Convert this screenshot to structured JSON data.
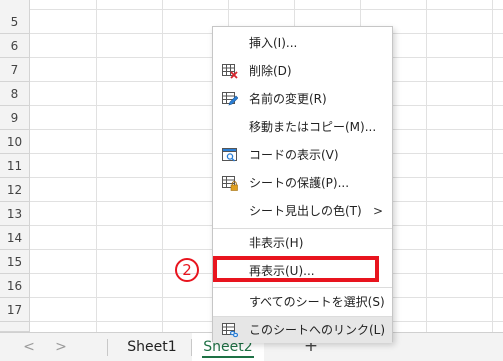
{
  "grid": {
    "rows": [
      "5",
      "6",
      "7",
      "8",
      "9",
      "10",
      "11",
      "12",
      "13",
      "14",
      "15",
      "16",
      "17"
    ]
  },
  "tabs": {
    "nav_prev": "<",
    "nav_next": ">",
    "sheet1": "Sheet1",
    "sheet2": "Sheet2",
    "add": "+"
  },
  "menu": {
    "items": [
      {
        "label": "挿入(I)...",
        "icon": "none"
      },
      {
        "label": "削除(D)",
        "icon": "delete-sheet-icon"
      },
      {
        "label": "名前の変更(R)",
        "icon": "rename-sheet-icon"
      },
      {
        "label": "移動またはコピー(M)...",
        "icon": "none"
      },
      {
        "label": "コードの表示(V)",
        "icon": "view-code-icon"
      },
      {
        "label": "シートの保護(P)...",
        "icon": "protect-sheet-icon"
      },
      {
        "label": "シート見出しの色(T)",
        "icon": "none",
        "submenu": ">"
      },
      {
        "label": "非表示(H)",
        "icon": "none"
      },
      {
        "label": "再表示(U)...",
        "icon": "none"
      },
      {
        "label": "すべてのシートを選択(S)",
        "icon": "none"
      },
      {
        "label": "このシートへのリンク(L)",
        "icon": "link-sheet-icon"
      }
    ]
  },
  "annotation": {
    "step": "2",
    "color": "#e8141e"
  },
  "colors": {
    "accent": "#1e7145",
    "highlight": "#e8141e"
  }
}
